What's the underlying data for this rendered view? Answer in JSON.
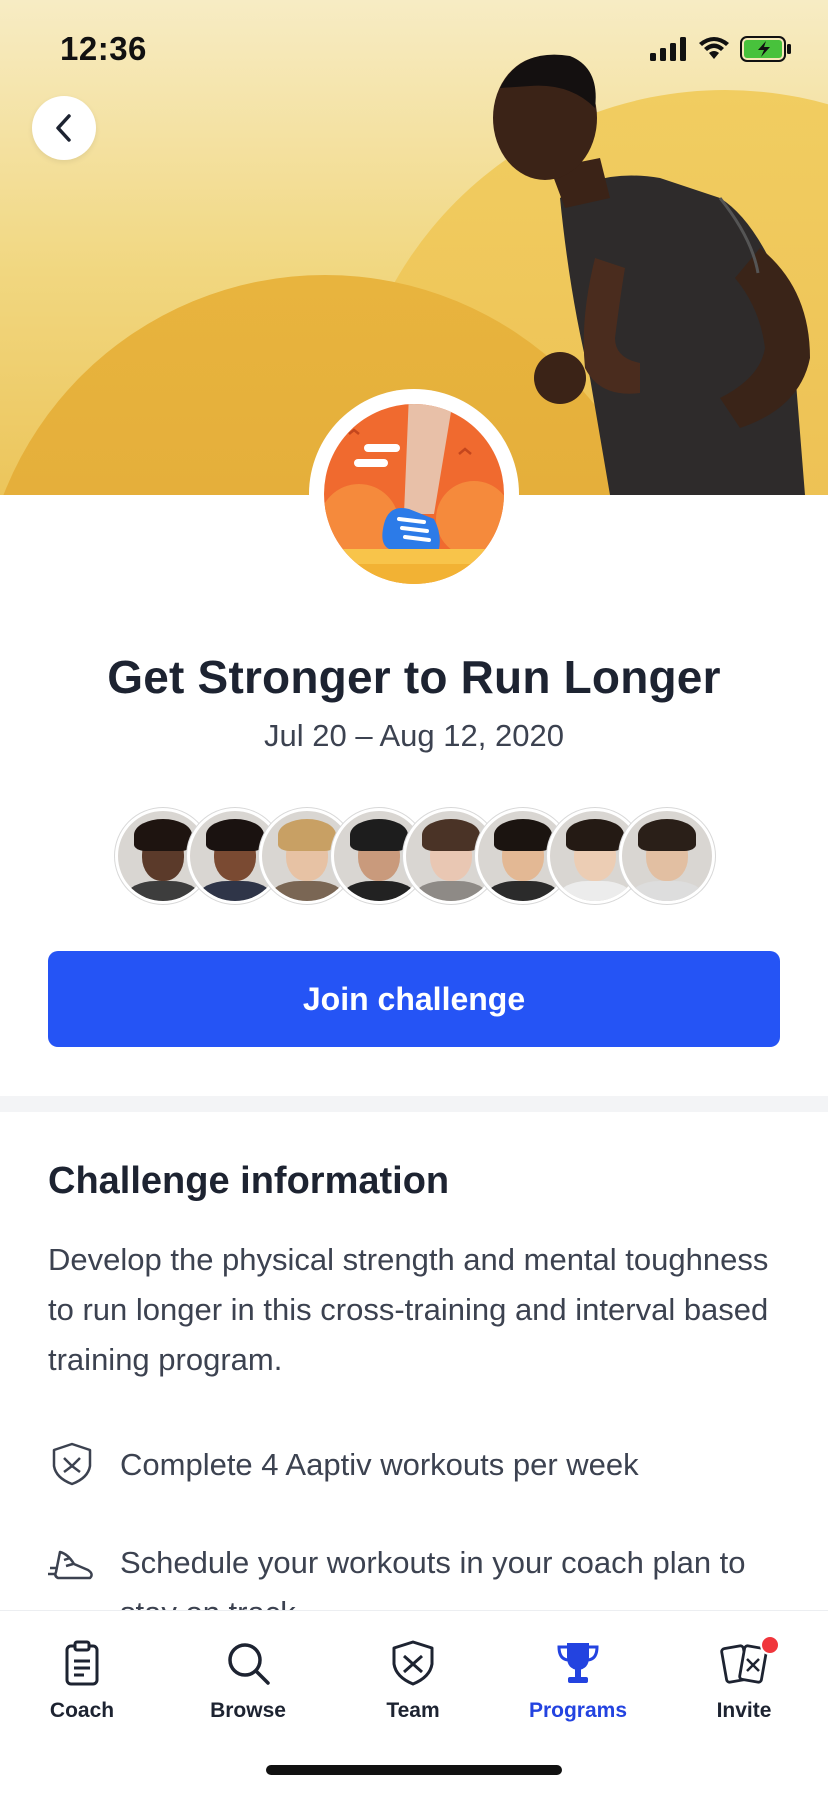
{
  "status_bar": {
    "time": "12:36"
  },
  "challenge": {
    "title": "Get Stronger to Run Longer",
    "dates": "Jul 20 – Aug 12, 2020",
    "join_label": "Join challenge"
  },
  "participants": [
    {
      "skin": "#5b3a2a",
      "hair": "#1e1410",
      "shirt": "#3d3d3d"
    },
    {
      "skin": "#7a4a32",
      "hair": "#1a1210",
      "shirt": "#2f3548"
    },
    {
      "skin": "#e7c2a4",
      "hair": "#c8a064",
      "shirt": "#7a6654"
    },
    {
      "skin": "#c99a7c",
      "hair": "#1d1d1d",
      "shirt": "#222222"
    },
    {
      "skin": "#e9c7b3",
      "hair": "#4a3326",
      "shirt": "#8e8a86"
    },
    {
      "skin": "#e3b894",
      "hair": "#1b1410",
      "shirt": "#2b2b2b"
    },
    {
      "skin": "#eccdb4",
      "hair": "#241a14",
      "shirt": "#ececec"
    },
    {
      "skin": "#e2bfa2",
      "hair": "#2a1f18",
      "shirt": "#dddddd"
    }
  ],
  "info": {
    "heading": "Challenge information",
    "description": "Develop the physical strength and mental toughness to run longer in this cross-training and interval based training program.",
    "requirements": [
      {
        "icon": "aaptiv-shield-icon",
        "text": "Complete 4 Aaptiv workouts per week"
      },
      {
        "icon": "running-shoe-icon",
        "text": "Schedule your workouts in your coach plan to stay on track"
      }
    ]
  },
  "tabs": [
    {
      "label": "Coach",
      "icon": "clipboard-icon"
    },
    {
      "label": "Browse",
      "icon": "search-icon"
    },
    {
      "label": "Team",
      "icon": "team-shield-icon"
    },
    {
      "label": "Programs",
      "icon": "trophy-icon",
      "active": true
    },
    {
      "label": "Invite",
      "icon": "invite-phones-icon",
      "notification": true
    }
  ],
  "colors": {
    "accent": "#2554f5",
    "active_tab": "#2343e0",
    "hero_yellow": "#eab84a",
    "badge_orange": "#f06a2f"
  }
}
